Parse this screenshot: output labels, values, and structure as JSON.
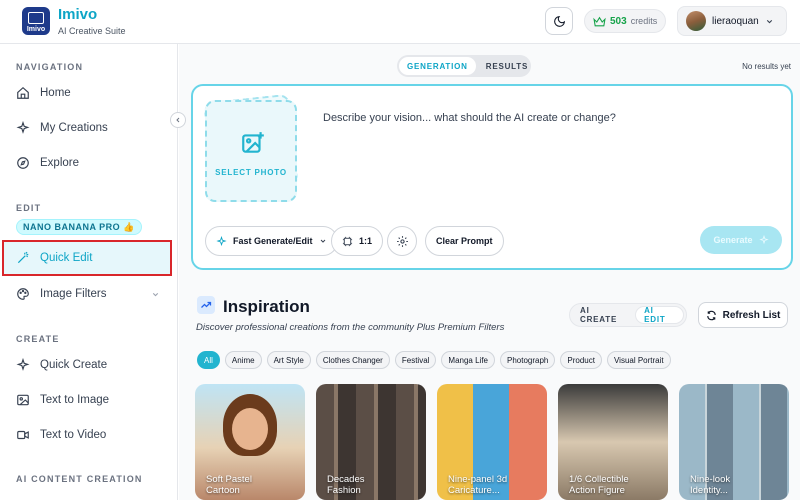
{
  "header": {
    "app_name": "Imivo",
    "app_subtitle": "AI Creative Suite",
    "logo_text": "Imivo",
    "credits_value": "503",
    "credits_label": "credits",
    "username": "lieraoquan"
  },
  "sidebar": {
    "navigation_label": "NAVIGATION",
    "nav": [
      {
        "label": "Home",
        "icon": "home-icon"
      },
      {
        "label": "My Creations",
        "icon": "sparkle-icon"
      },
      {
        "label": "Explore",
        "icon": "compass-icon"
      }
    ],
    "edit_label": "EDIT",
    "badge": "NANO BANANA PRO 👍",
    "edit_items": [
      {
        "label": "Quick Edit",
        "icon": "magic-wand-icon",
        "active": true
      },
      {
        "label": "Image Filters",
        "icon": "palette-icon"
      }
    ],
    "create_label": "CREATE",
    "create_items": [
      {
        "label": "Quick Create",
        "icon": "sparkle-icon"
      },
      {
        "label": "Text to Image",
        "icon": "image-icon"
      },
      {
        "label": "Text to Video",
        "icon": "video-icon"
      }
    ],
    "ai_content_label": "AI CONTENT CREATION"
  },
  "main": {
    "tabs": [
      "GENERATION",
      "RESULTS"
    ],
    "no_results": "No results yet",
    "select_photo": "SELECT PHOTO",
    "prompt_placeholder": "Describe your vision... what should the AI create or change?",
    "mode_button": "Fast Generate/Edit",
    "ratio_button": "1:1",
    "clear_button": "Clear Prompt",
    "generate_button": "Generate",
    "inspiration_title": "Inspiration",
    "inspiration_subtitle": "Discover professional creations from the community Plus Premium Filters",
    "modes": [
      "AI CREATE",
      "AI EDIT"
    ],
    "refresh_button": "Refresh List",
    "chips": [
      "All",
      "Anime",
      "Art Style",
      "Clothes Changer",
      "Festival",
      "Manga Life",
      "Photograph",
      "Product",
      "Visual Portrait"
    ],
    "cards": [
      {
        "line1": "Soft Pastel",
        "line2": "Cartoon"
      },
      {
        "line1": "Decades",
        "line2": "Fashion"
      },
      {
        "line1": "Nine-panel 3d",
        "line2": "Caricature..."
      },
      {
        "line1": "1/6 Collectible",
        "line2": "Action Figure"
      },
      {
        "line1": "Nine-look",
        "line2": "Identity..."
      }
    ]
  },
  "colors": {
    "accent": "#0ea5c6",
    "highlight_border": "#d9262b",
    "credits_green": "#16a34a"
  }
}
